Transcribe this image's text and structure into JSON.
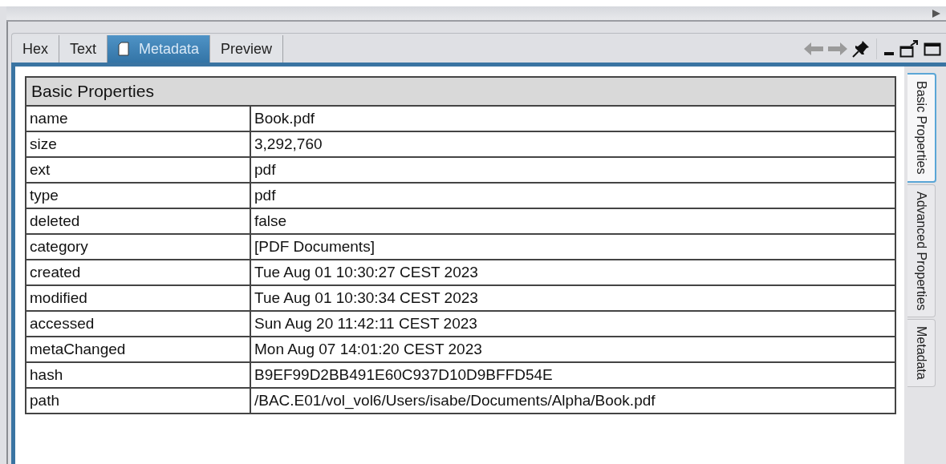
{
  "tabs": [
    {
      "label": "Hex",
      "selected": false,
      "kind": "plain"
    },
    {
      "label": "Text",
      "selected": false,
      "kind": "plain"
    },
    {
      "label": "Metadata",
      "selected": true,
      "kind": "document"
    },
    {
      "label": "Preview",
      "selected": false,
      "kind": "plain"
    }
  ],
  "toolbar": [
    {
      "kind": "back",
      "disabled": true
    },
    {
      "kind": "forward",
      "disabled": true
    },
    {
      "kind": "pin",
      "disabled": false
    },
    {
      "kind": "minimize",
      "disabled": false
    },
    {
      "kind": "undock",
      "disabled": false
    },
    {
      "kind": "maximize",
      "disabled": false
    }
  ],
  "table": {
    "title": "Basic Properties",
    "rows": [
      {
        "key": "name",
        "value": "Book.pdf"
      },
      {
        "key": "size",
        "value": "3,292,760"
      },
      {
        "key": "ext",
        "value": "pdf"
      },
      {
        "key": "type",
        "value": "pdf"
      },
      {
        "key": "deleted",
        "value": "false"
      },
      {
        "key": "category",
        "value": "[PDF Documents]"
      },
      {
        "key": "created",
        "value": "Tue Aug 01 10:30:27 CEST 2023"
      },
      {
        "key": "modified",
        "value": "Tue Aug 01 10:30:34 CEST 2023"
      },
      {
        "key": "accessed",
        "value": "Sun Aug 20 11:42:11 CEST 2023"
      },
      {
        "key": "metaChanged",
        "value": "Mon Aug 07 14:01:20 CEST 2023"
      },
      {
        "key": "hash",
        "value": "B9EF99D2BB491E60C937D10D9BFFD54E"
      },
      {
        "key": "path",
        "value": "/BAC.E01/vol_vol6/Users/isabe/Documents/Alpha/Book.pdf"
      }
    ]
  },
  "side_tabs": [
    {
      "label": "Basic Properties",
      "selected": true
    },
    {
      "label": "Advanced Properties",
      "selected": false
    },
    {
      "label": "Metadata",
      "selected": false
    }
  ]
}
